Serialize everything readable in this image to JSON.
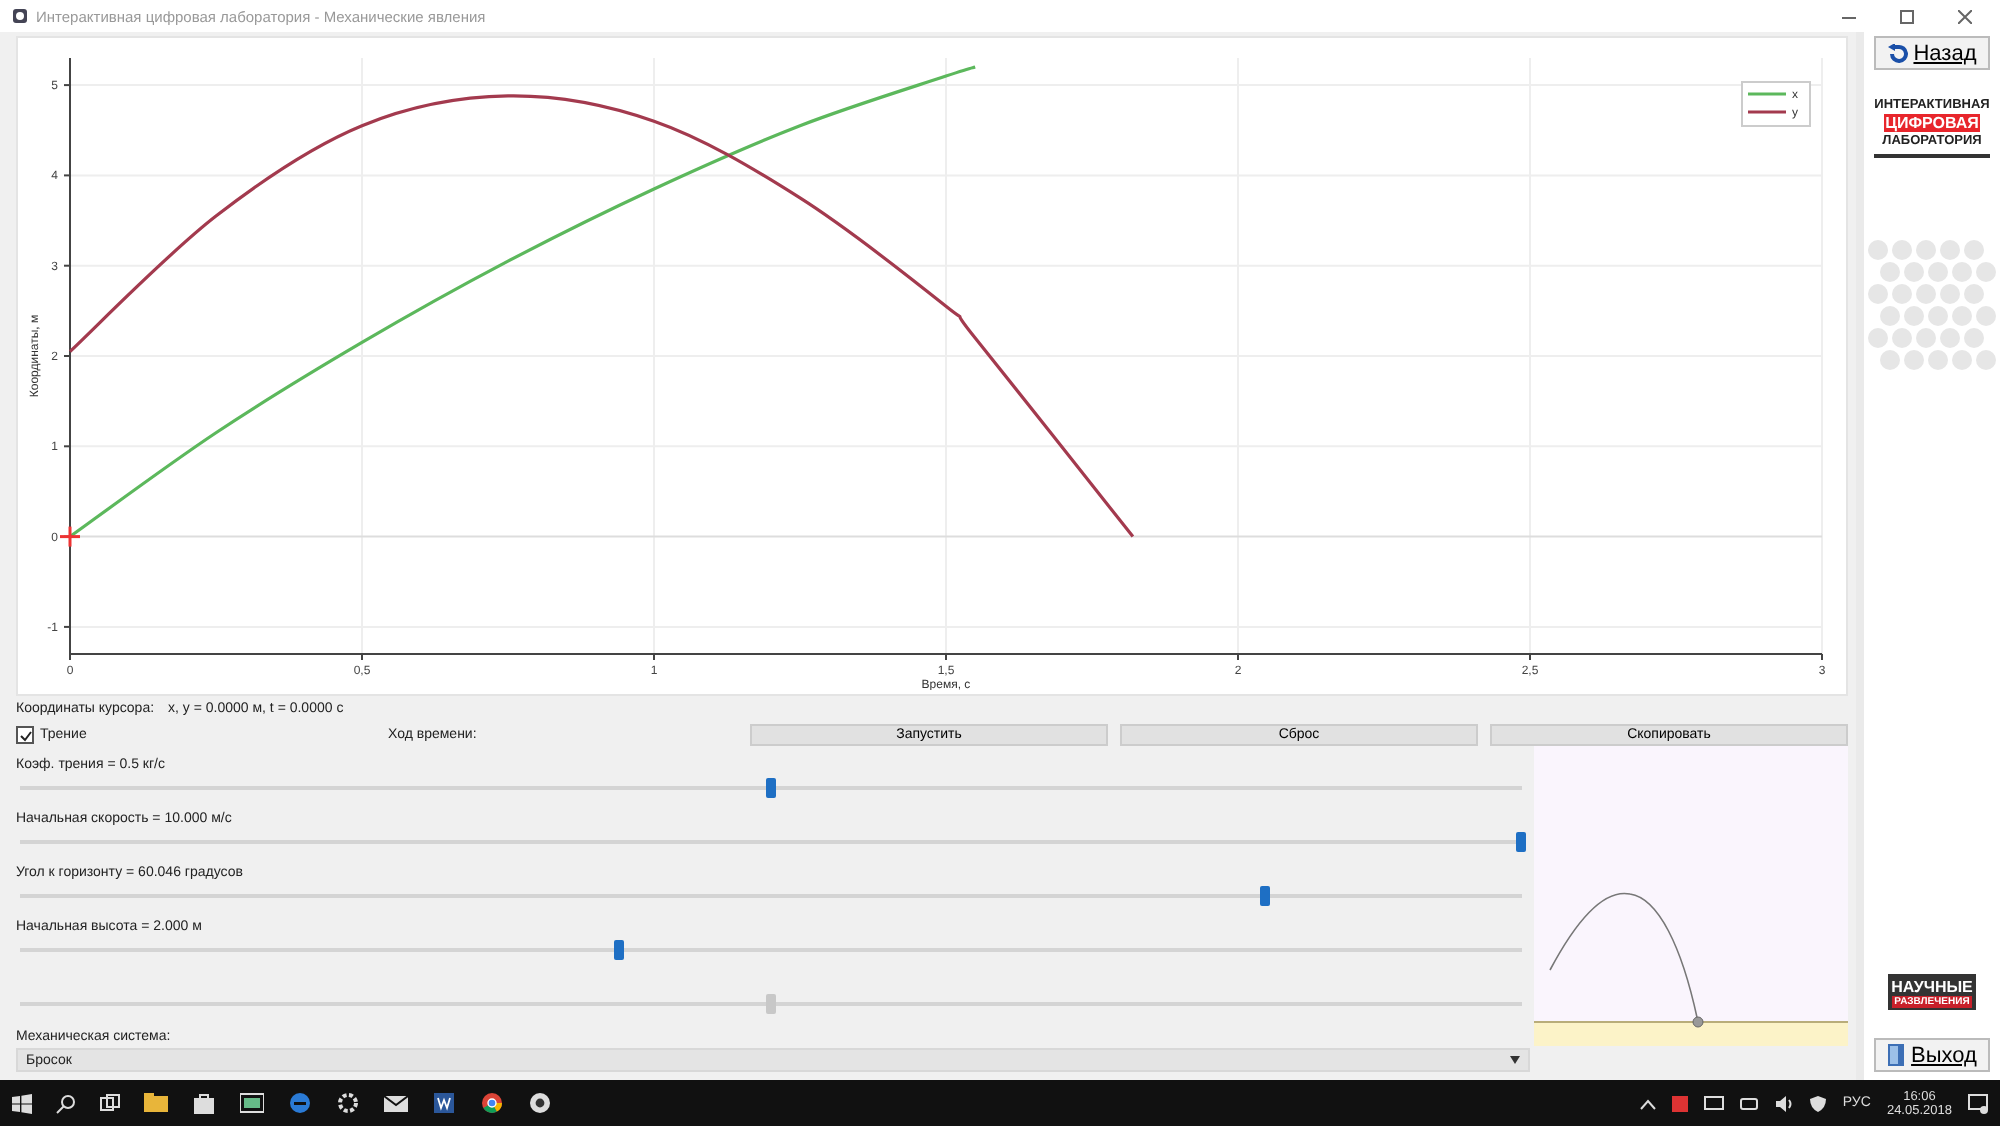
{
  "window": {
    "title": "Интерактивная цифровая лаборатория - Механические явления"
  },
  "chart": {
    "chart_data": {
      "type": "line",
      "xlabel": "Время, с",
      "ylabel": "Координаты, м",
      "x": [
        0,
        0.25,
        0.5,
        0.75,
        1,
        1.25,
        1.5,
        1.55,
        1.82
      ],
      "series": [
        {
          "name": "x",
          "color": "#5cb85c",
          "values": [
            0,
            1.15,
            2.15,
            3.05,
            3.85,
            4.55,
            5.1,
            5.2,
            null
          ]
        },
        {
          "name": "y",
          "color": "#a33a4e",
          "values": [
            2.05,
            3.55,
            4.55,
            4.88,
            4.6,
            3.75,
            2.55,
            2.2,
            0
          ]
        }
      ],
      "xlim": [
        0,
        3
      ],
      "ylim": [
        -1.3,
        5.3
      ],
      "xticks": [
        0,
        {
          "value": 0.5,
          "label": "0,5"
        },
        1,
        {
          "value": 1.5,
          "label": "1,5"
        },
        2,
        {
          "value": 2.5,
          "label": "2,5"
        },
        3
      ],
      "yticks": [
        -1,
        0,
        1,
        2,
        3,
        4,
        5
      ],
      "grid": true,
      "legend": true
    }
  },
  "cursor": {
    "label": "Координаты курсора:",
    "value": "x, y = 0.0000 м,   t = 0.0000 с"
  },
  "friction_checkbox": {
    "label": "Трение",
    "checked": true
  },
  "time_label": "Ход времени:",
  "buttons": [
    "Запустить",
    "Сброс",
    "Скопировать"
  ],
  "sliders": [
    {
      "label": "Коэф. трения = 0.5 кг/с",
      "level": 0.5,
      "disabled": false
    },
    {
      "label": "Начальная скорость = 10.000 м/с",
      "level": 1.0,
      "disabled": false
    },
    {
      "label": "Угол к горизонту = 60.046 градусов",
      "level": 0.83,
      "disabled": false
    },
    {
      "label": "Начальная высота = 2.000 м",
      "level": 0.4,
      "disabled": false
    },
    {
      "level": 0.5,
      "disabled": true
    }
  ],
  "system": {
    "label": "Механическая система:",
    "value": "Бросок"
  },
  "sidebar": {
    "back_button": "Назад",
    "logo_lines": [
      "ИНТЕРАКТИВНАЯ",
      "ЦИФРОВАЯ",
      "ЛАБОРАТОРИЯ"
    ],
    "brand_lines": [
      "НАУЧНЫЕ",
      "РАЗВЛЕЧЕНИЯ"
    ],
    "exit_button": "Выход"
  },
  "taskbar": {
    "language": "РУС",
    "time": "16:06",
    "date": "24.05.2018"
  }
}
